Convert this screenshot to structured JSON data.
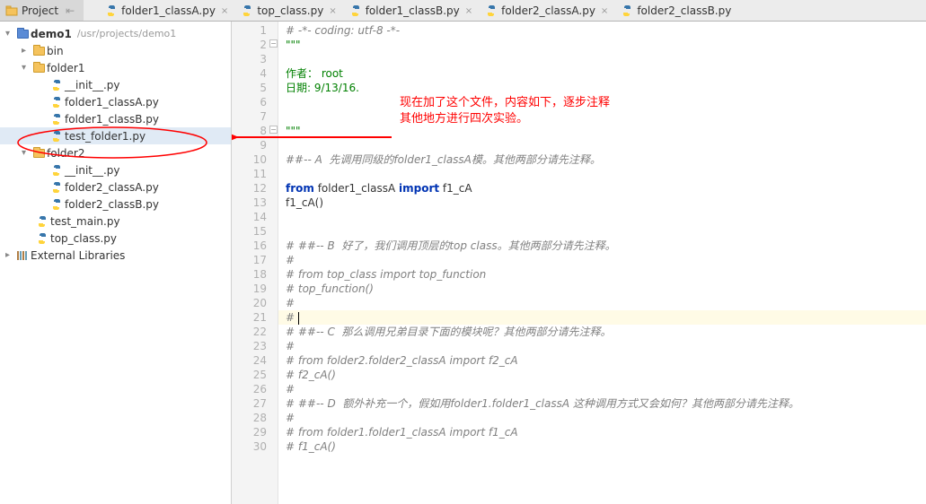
{
  "tool_panel": {
    "title": "Project"
  },
  "project": {
    "root": "demo1",
    "path": "/usr/projects/demo1",
    "bin": "bin",
    "folder1": "folder1",
    "folder2": "folder2",
    "files": {
      "init": "__init__.py",
      "f1_classA": "folder1_classA.py",
      "f1_classB": "folder1_classB.py",
      "test_folder1": "test_folder1.py",
      "f2_classA": "folder2_classA.py",
      "f2_classB": "folder2_classB.py",
      "test_main": "test_main.py",
      "top_class": "top_class.py"
    },
    "ext_lib": "External Libraries"
  },
  "tabs": {
    "t1": "folder1_classA.py",
    "t2": "top_class.py",
    "t3": "folder1_classB.py",
    "t4": "folder2_classA.py",
    "t5": "folder2_classB.py"
  },
  "code": {
    "l1": "# -*- coding: utf-8 -*-",
    "l2": "\"\"\"",
    "l3": "",
    "l4": "作者： root",
    "l5": "日期: 9/13/16.",
    "l6": "",
    "l7": "",
    "l8": "\"\"\"",
    "l9": "",
    "l10_a": "##-- A  先调用同级的folder1_classA模。",
    "l10_b": "其他两部分请先注释。",
    "l11": "",
    "l12_pre": "from",
    "l12_mid": " folder1_classA ",
    "l12_imp": "import",
    "l12_post": " f1_cA",
    "l13": "f1_cA()",
    "l14": "",
    "l15": "",
    "l16": "# ##-- B  好了，我们调用顶层的top class。其他两部分请先注释。",
    "l17": "#",
    "l18": "# from top_class import top_function",
    "l19": "# top_function()",
    "l20": "#",
    "l21": "# ",
    "l22": "# ##-- C  那么调用兄弟目录下面的模块呢？其他两部分请先注释。",
    "l23": "#",
    "l24": "# from folder2.folder2_classA import f2_cA",
    "l25": "# f2_cA()",
    "l26": "#",
    "l27": "# ##-- D  额外补充一个，假如用folder1.folder1_classA 这种调用方式又会如何？其他两部分请先注释。",
    "l28": "#",
    "l29": "# from folder1.folder1_classA import f1_cA",
    "l30": "# f1_cA()"
  },
  "annotation": {
    "line1": "现在加了这个文件，内容如下，逐步注释",
    "line2": "其他地方进行四次实验。"
  },
  "close_x": "×",
  "tri_down": "▾",
  "tri_right": "▸",
  "fold_minus": "−"
}
